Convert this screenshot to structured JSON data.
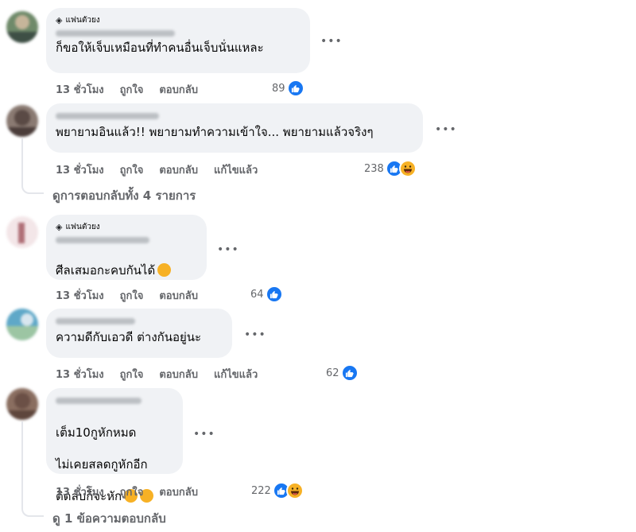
{
  "fan_badge": "แฟนตัวยง",
  "comments": [
    {
      "text": "ก็ขอให้เจ็บเหมือนที่ทำคนอื่นเจ็บนั่นแหละ",
      "time": "13 ชั่วโมง",
      "like": "ถูกใจ",
      "reply": "ตอบกลับ",
      "edited": "",
      "reaction_count": "89"
    },
    {
      "text": "พยายามอินแล้ว!! พยายามทำความเข้าใจ... พยายามแล้วจริงๆ",
      "time": "13 ชั่วโมง",
      "like": "ถูกใจ",
      "reply": "ตอบกลับ",
      "edited": "แก้ไขแล้ว",
      "reaction_count": "238"
    },
    {
      "text": "ศีลเสมอกะคบกันได้",
      "time": "13 ชั่วโมง",
      "like": "ถูกใจ",
      "reply": "ตอบกลับ",
      "edited": "",
      "reaction_count": "64"
    },
    {
      "text": "ความดีกับเอวดี ต่างกันอยู่นะ",
      "time": "13 ชั่วโมง",
      "like": "ถูกใจ",
      "reply": "ตอบกลับ",
      "edited": "แก้ไขแล้ว",
      "reaction_count": "62"
    },
    {
      "text_lines": [
        "เต็ม10กูหักหมด",
        "ไม่เคยสลดกูหักอีก",
        "ติดลบก็จะหัก"
      ],
      "time": "13 ชั่วโมง",
      "like": "ถูกใจ",
      "reply": "ตอบกลับ",
      "edited": "",
      "reaction_count": "222"
    }
  ],
  "view_replies_1": "ดูการตอบกลับทั้ง 4 รายการ",
  "view_replies_2": "ดู 1 ข้อความตอบกลับ",
  "icons": {
    "more": "more-dots-icon",
    "like": "like-reaction-icon",
    "haha": "haha-reaction-icon",
    "fan": "diamond-fan-icon"
  },
  "colors": {
    "bubble": "#f0f2f5",
    "muted": "#65676b",
    "like_blue": "#1877f2",
    "haha_yellow": "#f7b125"
  }
}
